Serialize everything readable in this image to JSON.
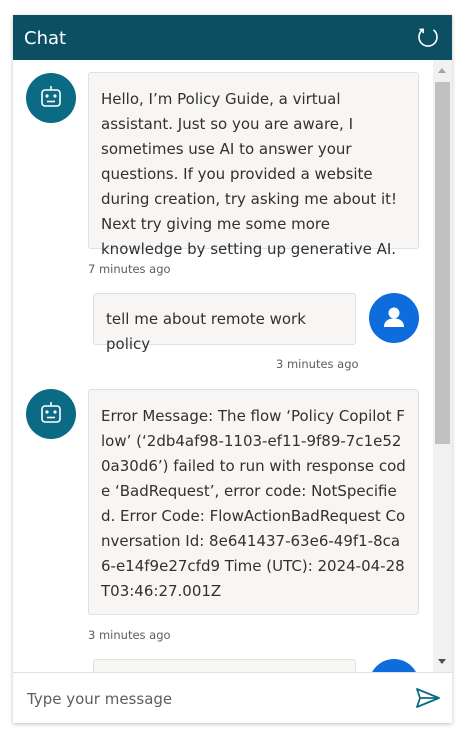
{
  "header": {
    "title": "Chat"
  },
  "messages": [
    {
      "sender": "bot",
      "text": "Hello, I’m Policy Guide, a virtual assistant. Just so you are aware, I sometimes use AI to answer your questions. If you provided a website during creation, try asking me about it! Next try giving me some more knowledge by setting up generative AI.",
      "time": "7 minutes ago"
    },
    {
      "sender": "user",
      "text": "tell me about remote work policy",
      "time": "3 minutes ago"
    },
    {
      "sender": "bot",
      "text": "Error Message: The flow ‘Policy Copilot Flow’ (‘2db4af98-1103-ef11-9f89-7c1e520a30d6’) failed to run with response code ‘BadRequest’, error code: NotSpecified. Error Code: FlowActionBadRequest Conversation Id: 8e641437-63e6-49f1-8ca6-e14f9e27cfd9 Time (UTC): 2024-04-28T03:46:27.001Z",
      "time": "3 minutes ago"
    }
  ],
  "composer": {
    "placeholder": "Type your message"
  },
  "colors": {
    "header": "#0c4f63",
    "bot_avatar": "#0b6a84",
    "user_avatar": "#0f6cdc",
    "send": "#0b6a84"
  }
}
